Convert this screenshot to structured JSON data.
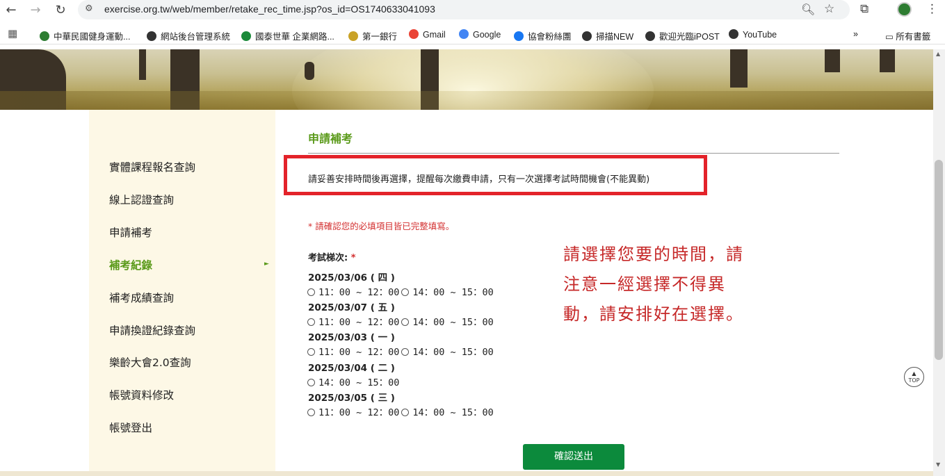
{
  "browser": {
    "url": "exercise.org.tw/web/member/retake_rec_time.jsp?os_id=OS1740633041093",
    "bookmarks": [
      {
        "label": "中華民國健身運動...",
        "icon_color": "#2e7d32"
      },
      {
        "label": "網站後台管理系統",
        "icon_color": "#333333"
      },
      {
        "label": "國泰世華 企業網路...",
        "icon_color": "#1b8a3a"
      },
      {
        "label": "第一銀行",
        "icon_color": "#c9a227"
      },
      {
        "label": "Gmail",
        "icon_color": "#ea4335"
      },
      {
        "label": "Google",
        "icon_color": "#4285f4"
      },
      {
        "label": "協會粉絲團",
        "icon_color": "#1877f2"
      },
      {
        "label": "掃描NEW",
        "icon_color": "#333333"
      },
      {
        "label": "歡迎光臨iPOST",
        "icon_color": "#333333"
      },
      {
        "label": "YouTube",
        "icon_color": "#333333"
      }
    ],
    "all_bookmarks_label": "所有書籤",
    "more_label": "»"
  },
  "sidebar": {
    "items": [
      {
        "label": "實體課程報名查詢",
        "active": false
      },
      {
        "label": "線上認證查詢",
        "active": false
      },
      {
        "label": "申請補考",
        "active": false
      },
      {
        "label": "補考紀錄",
        "active": true
      },
      {
        "label": "補考成績查詢",
        "active": false
      },
      {
        "label": "申請換證紀錄查詢",
        "active": false
      },
      {
        "label": "樂齡大會2.0查詢",
        "active": false
      },
      {
        "label": "帳號資料修改",
        "active": false
      },
      {
        "label": "帳號登出",
        "active": false
      }
    ],
    "active_marker": "►"
  },
  "main": {
    "title": "申請補考",
    "notice": "請妥善安排時間後再選擇，提醒每次繳費申請，只有一次選擇考試時間機會(不能異動)",
    "required_note": "* 請確認您的必填項目皆已完整填寫。",
    "field_label": "考試梯次:",
    "required_star": "*",
    "schedule": [
      {
        "date": "2025/03/06 ( 四 )",
        "slots": [
          "11：00 ~ 12：00",
          "14：00 ~ 15：00"
        ]
      },
      {
        "date": "2025/03/07 ( 五 )",
        "slots": [
          "11：00 ~ 12：00",
          "14：00 ~ 15：00"
        ]
      },
      {
        "date": "2025/03/03 ( 一 )",
        "slots": [
          "11：00 ~ 12：00",
          "14：00 ~ 15：00"
        ]
      },
      {
        "date": "2025/03/04 ( 二 )",
        "slots": [
          "14：00 ~ 15：00"
        ]
      },
      {
        "date": "2025/03/05 ( 三 )",
        "slots": [
          "11：00 ~ 12：00",
          "14：00 ~ 15：00"
        ]
      }
    ],
    "submit_label": "確認送出",
    "top_label": "TOP"
  },
  "annotation": {
    "lines": [
      "請選擇您要的時間，請",
      "注意一經選擇不得異",
      "動，請安排好在選擇。"
    ]
  },
  "colors": {
    "accent_green": "#5a9a1a",
    "notice_border": "#e3232a",
    "submit_green": "#0c8a3c",
    "annotation_red": "#c62828"
  }
}
